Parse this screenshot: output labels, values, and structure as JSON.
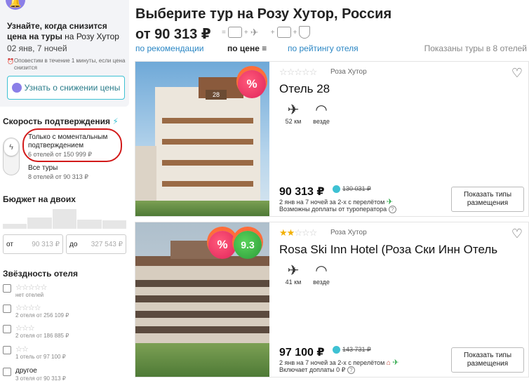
{
  "notify": {
    "title_bold": "Узнайте, когда снизится цена на туры",
    "title_rest": " на Розу Хутор",
    "dates": "02 янв, 7 ночей",
    "note": "Оповестим в течение 1 минуты, если цена снизится",
    "button_label": "Узнать о снижении цены"
  },
  "speed": {
    "title": "Скорость подтверждения",
    "instant_label": "Только с моментальным подтверждением",
    "instant_sub": "6 отелей от 150 999 ₽",
    "all_label": "Все туры",
    "all_sub": "8 отелей от 90 313 ₽"
  },
  "budget": {
    "title": "Бюджет на двоих",
    "from_prefix": "от",
    "from_value": "90 313 ₽",
    "to_prefix": "до",
    "to_value": "327 543 ₽",
    "histogram": [
      0.25,
      0.55,
      0.95,
      0.45,
      0.4
    ]
  },
  "stars_filter": {
    "title": "Звёздность отеля",
    "rows": [
      {
        "stars": "☆☆☆☆☆",
        "sub": "нет отелей"
      },
      {
        "stars": "☆☆☆☆",
        "sub": "2 отеля от 256 109 ₽"
      },
      {
        "stars": "☆☆☆",
        "sub": "2 отеля от 186 885 ₽"
      },
      {
        "stars": "☆☆",
        "sub": "1 отель от 97 100 ₽"
      },
      {
        "label": "другое",
        "sub": "3 отеля от 90 313 ₽"
      }
    ]
  },
  "header": {
    "title": "Выберите тур на Розу Хутор, Россия",
    "price": "от 90 313 ₽",
    "eq": "=",
    "plus": "+"
  },
  "sort": {
    "recommend": "по рекомендации",
    "price": "по цене",
    "rating": "по рейтингу отеля",
    "shown": "Показаны туры в 8 отелей"
  },
  "hotels": [
    {
      "resort": "Роза Хутор",
      "stars_on": "",
      "stars_off": "☆☆☆☆☆",
      "name": "Отель 28",
      "badge_pct": "%",
      "distance": "52 км",
      "wifi": "везде",
      "price": "90 313 ₽",
      "old_price": "130 031 ₽",
      "details": "2 янв на 7 ночей за 2-х с перелётом",
      "extra": "Возможны доплаты от туроператора",
      "button": "Показать типы размещения",
      "building_label": "28"
    },
    {
      "resort": "Роза Хутор",
      "stars_on": "★★",
      "stars_off": "☆☆☆",
      "name": "Rosa Ski Inn Hotel (Роза Ски Инн Отель",
      "badge_pct": "%",
      "rating": "9.3",
      "distance": "41 км",
      "wifi": "везде",
      "price": "97 100 ₽",
      "old_price": "143 731 ₽",
      "details": "2 янв на 7 ночей за 2-х с перелётом",
      "extra": "Включает доплаты 0 ₽",
      "button": "Показать типы размещения"
    }
  ],
  "colors": {
    "accent": "#3ec1d3",
    "link": "#2a86c4",
    "bell": "#8b7fe8",
    "highlight": "#d21a1a",
    "star": "#f2b000"
  }
}
